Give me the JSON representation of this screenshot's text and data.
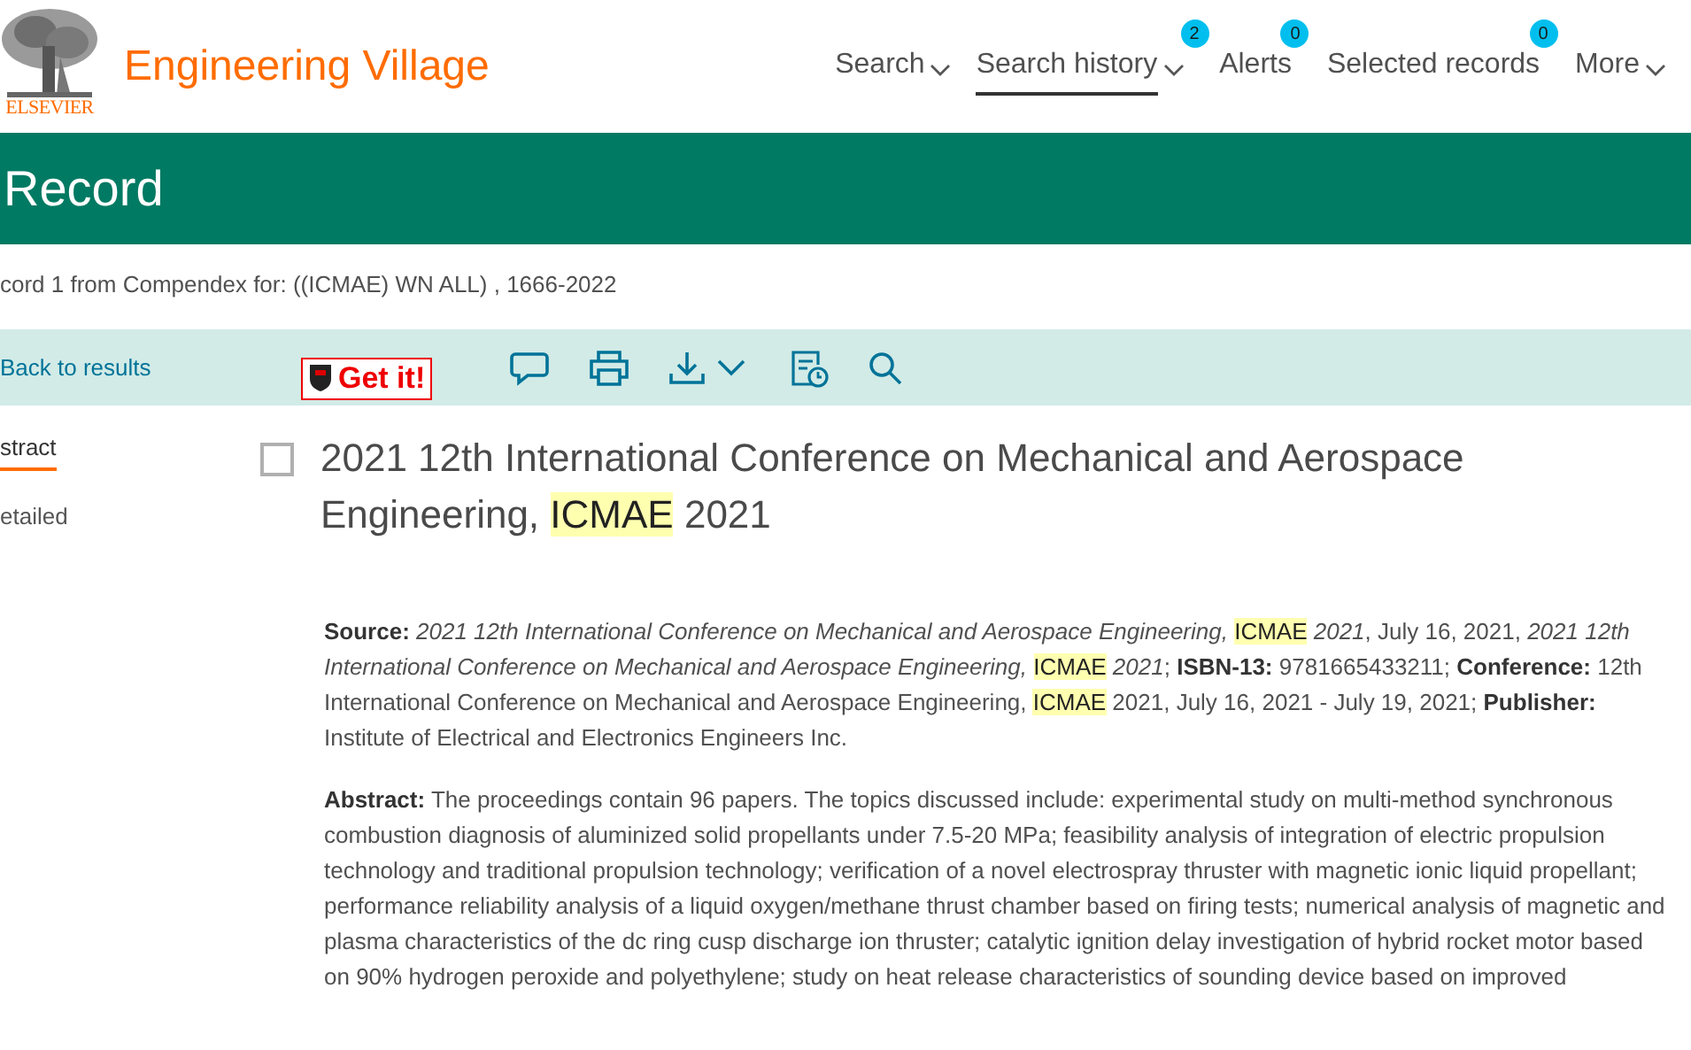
{
  "header": {
    "publisher": "ELSEVIER",
    "product": "Engineering Village",
    "nav": [
      {
        "label": "Search",
        "dropdown": true,
        "selected": false
      },
      {
        "label": "Search history",
        "dropdown": true,
        "selected": true,
        "badge": "2"
      },
      {
        "label": "Alerts",
        "dropdown": false,
        "selected": false,
        "badge": "0"
      },
      {
        "label": "Selected records",
        "dropdown": false,
        "selected": false,
        "badge": "0"
      },
      {
        "label": "More",
        "dropdown": true,
        "selected": false
      }
    ]
  },
  "banner": {
    "title": "Record"
  },
  "breadcrumb": "cord 1 from Compendex for: ((ICMAE) WN ALL) , 1666-2022",
  "toolbar": {
    "back": "Back to results",
    "get_it": "Get it!",
    "tools": [
      {
        "kind": "comment"
      },
      {
        "kind": "print"
      },
      {
        "kind": "download"
      },
      {
        "kind": "history"
      },
      {
        "kind": "search"
      }
    ]
  },
  "side_tabs": [
    {
      "label": "stract",
      "selected": true
    },
    {
      "label": "etailed",
      "selected": false
    }
  ],
  "record": {
    "checked": false,
    "title": [
      {
        "kind": "plain",
        "text": "2021 12th International Conference on Mechanical and Aerospace Engineering, "
      },
      {
        "kind": "highlight",
        "text": "ICMAE"
      },
      {
        "kind": "plain",
        "text": " 2021"
      }
    ],
    "source": [
      {
        "kind": "label",
        "text": "Source:"
      },
      {
        "kind": "italic",
        "text": " 2021 12th International Conference on Mechanical and Aerospace Engineering, "
      },
      {
        "kind": "highlight",
        "text": "ICMAE"
      },
      {
        "kind": "italic",
        "text": " 2021"
      },
      {
        "kind": "plain",
        "text": ", July 16, 2021, "
      },
      {
        "kind": "italic",
        "text": "2021 12th International Conference on Mechanical and Aerospace Engineering, "
      },
      {
        "kind": "highlight",
        "text": "ICMAE"
      },
      {
        "kind": "italic",
        "text": " 2021"
      },
      {
        "kind": "plain",
        "text": ";  "
      },
      {
        "kind": "label",
        "text": "ISBN-13:"
      },
      {
        "kind": "plain",
        "text": " 9781665433211; "
      },
      {
        "kind": "label",
        "text": "Conference:"
      },
      {
        "kind": "plain",
        "text": " 12th International Conference on Mechanical and Aerospace Engineering, "
      },
      {
        "kind": "highlight",
        "text": "ICMAE"
      },
      {
        "kind": "plain",
        "text": " 2021, July 16, 2021 - July 19, 2021; "
      },
      {
        "kind": "label",
        "text": "Publisher:"
      },
      {
        "kind": "plain",
        "text": " Institute of Electrical and Electronics Engineers Inc."
      }
    ],
    "abstract": [
      {
        "kind": "label",
        "text": "Abstract:"
      },
      {
        "kind": "plain",
        "text": " The proceedings contain 96 papers. The topics discussed include: experimental study on multi-method synchronous combustion diagnosis of aluminized solid propellants under 7.5-20 MPa; feasibility analysis of integration of electric propulsion technology and traditional propulsion technology; verification of a novel electrospray thruster with magnetic ionic liquid propellant; performance reliability analysis of a liquid oxygen/methane thrust chamber based on firing tests; numerical analysis of magnetic and plasma characteristics of the dc ring cusp discharge ion thruster; catalytic ignition delay investigation of hybrid rocket motor based on 90% hydrogen peroxide and polyethylene; study on heat release characteristics of sounding device based on improved"
      }
    ]
  }
}
